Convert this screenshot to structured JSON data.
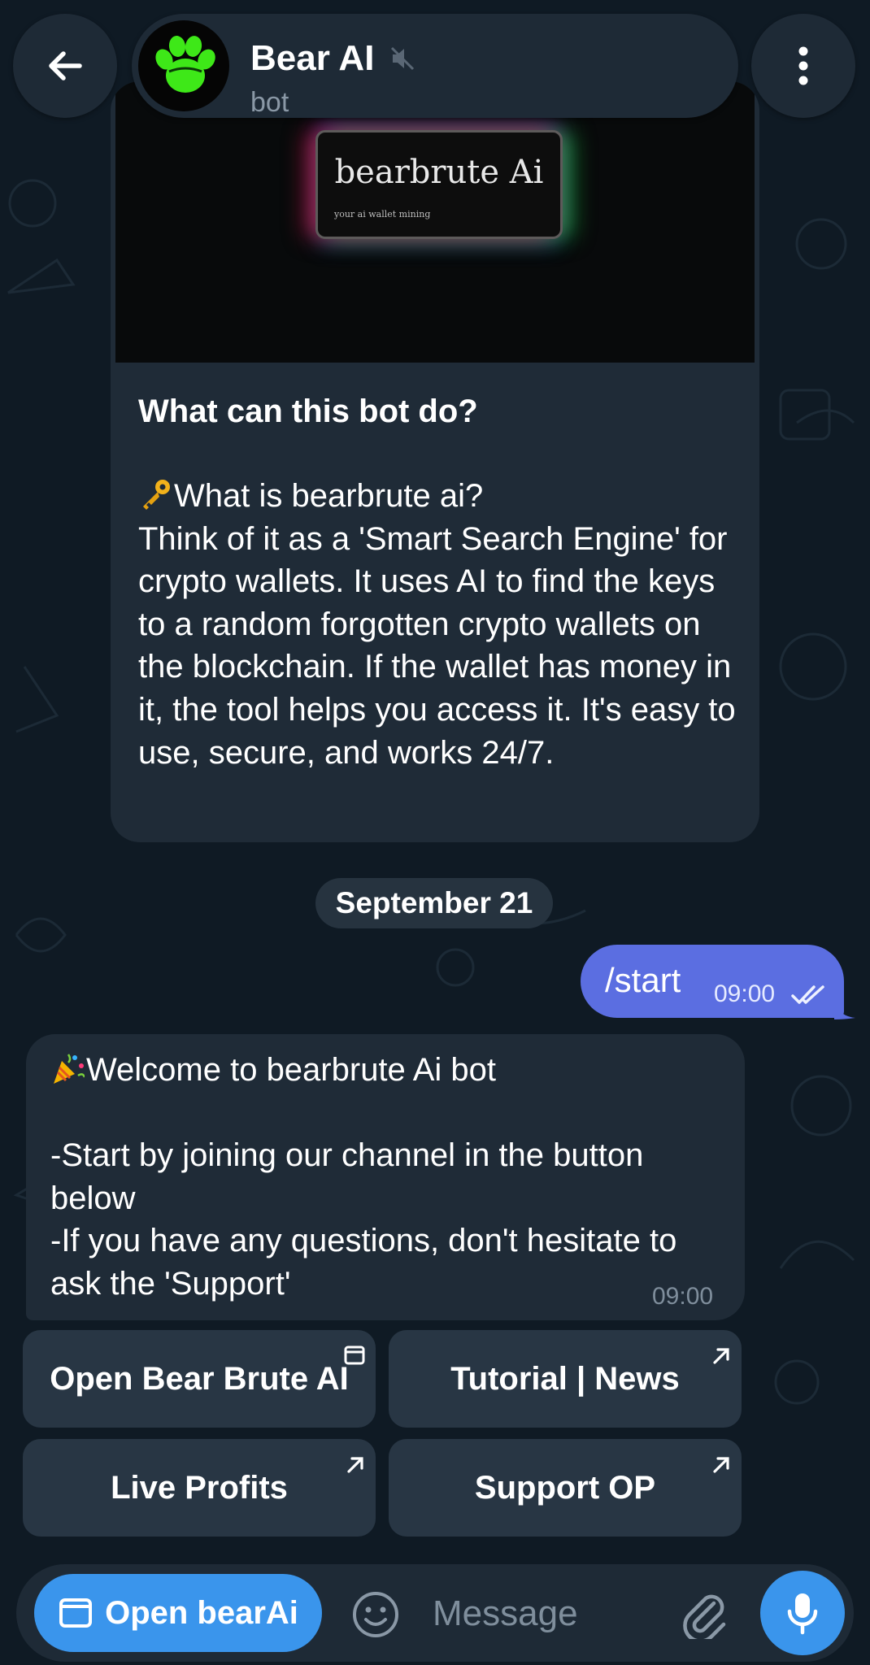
{
  "header": {
    "title": "Bear AI",
    "subtitle": "bot",
    "back_icon": "arrow-left-icon",
    "menu_icon": "more-vertical-icon",
    "muted_icon": "muted-speaker-icon"
  },
  "intro": {
    "media_title": "bearbrute Ai",
    "media_subtitle": "your ai wallet mining",
    "heading": "What can this bot do?",
    "question": "What is bearbrute ai?",
    "description": "Think of it as a 'Smart Search Engine' for crypto wallets. It uses AI to find the keys to a random forgotten crypto wallets on the blockchain. If the wallet has money in it, the tool helps you access it. It's easy to use, secure, and works 24/7.",
    "question_icon": "key-icon"
  },
  "date_chip": "September 21",
  "outgoing": {
    "text": "/start",
    "time": "09:00",
    "status_icon": "double-check-icon"
  },
  "incoming": {
    "text": "Welcome to bearbrute Ai bot\n\n-Start by joining our channel in the button below\n-If you have any questions, don't hesitate to ask the 'Support'",
    "time": "09:00",
    "lead_icon": "party-popper-icon"
  },
  "keyboard": {
    "buttons": [
      {
        "label": "Open Bear Brute AI",
        "icon": "web-app-icon"
      },
      {
        "label": "Tutorial | News",
        "icon": "external-link-arrow-icon"
      },
      {
        "label": "Live Profits",
        "icon": "external-link-arrow-icon"
      },
      {
        "label": "Support OP",
        "icon": "external-link-arrow-icon"
      }
    ]
  },
  "composer": {
    "open_app_label": "Open bearAi",
    "placeholder": "Message"
  },
  "colors": {
    "background": "#0f1a24",
    "bubble": "#1f2b37",
    "outgoing_bubble": "#5b6ee1",
    "accent": "#3a95ec",
    "avatar_paw": "#3ee818"
  }
}
